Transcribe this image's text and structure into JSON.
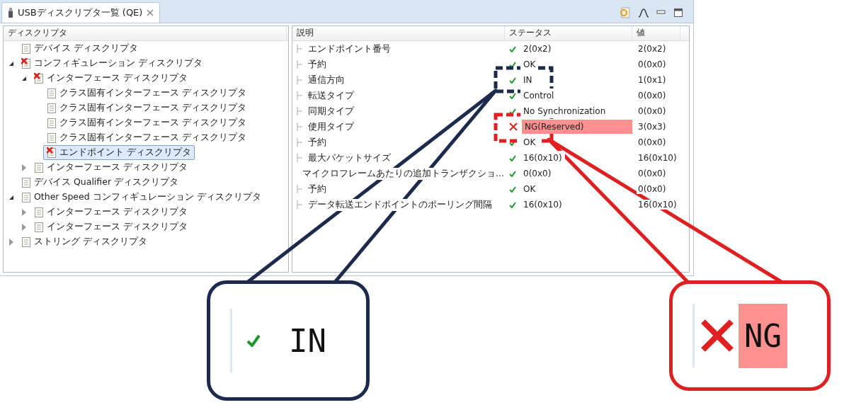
{
  "window": {
    "title": "USBディスクリプタ一覧 (QE)"
  },
  "tree": {
    "header": "ディスクリプタ",
    "items": [
      {
        "label": "デバイス ディスクリプタ",
        "error": false,
        "selected": false
      },
      {
        "label": "コンフィギュレーション ディスクリプタ",
        "error": true,
        "selected": false,
        "expanded": true,
        "children": [
          {
            "label": "インターフェース ディスクリプタ",
            "error": true,
            "selected": false,
            "expanded": true,
            "children": [
              {
                "label": "クラス固有インターフェース ディスクリプタ",
                "error": false,
                "selected": false
              },
              {
                "label": "クラス固有インターフェース ディスクリプタ",
                "error": false,
                "selected": false
              },
              {
                "label": "クラス固有インターフェース ディスクリプタ",
                "error": false,
                "selected": false
              },
              {
                "label": "クラス固有インターフェース ディスクリプタ",
                "error": false,
                "selected": false
              },
              {
                "label": "エンドポイント ディスクリプタ",
                "error": true,
                "selected": true
              }
            ]
          },
          {
            "label": "インターフェース ディスクリプタ",
            "error": false,
            "selected": false,
            "expanded": false
          }
        ]
      },
      {
        "label": "デバイス Qualifier ディスクリプタ",
        "error": false,
        "selected": false
      },
      {
        "label": "Other Speed コンフィギュレーション ディスクリプタ",
        "error": false,
        "selected": false,
        "expanded": true,
        "children": [
          {
            "label": "インターフェース ディスクリプタ",
            "error": false,
            "selected": false,
            "expanded": false
          },
          {
            "label": "インターフェース ディスクリプタ",
            "error": false,
            "selected": false,
            "expanded": false
          }
        ]
      },
      {
        "label": "ストリング ディスクリプタ",
        "error": false,
        "selected": false,
        "expanded": false
      }
    ]
  },
  "table": {
    "columns": [
      "説明",
      "ステータス",
      "値"
    ],
    "rows": [
      {
        "description": "エンドポイント番号",
        "ok": true,
        "status": "2(0x2)",
        "value": "2(0x2)"
      },
      {
        "description": "予約",
        "ok": true,
        "status": "OK",
        "value": "0(0x0)"
      },
      {
        "description": "通信方向",
        "ok": true,
        "status": "IN",
        "value": "1(0x1)"
      },
      {
        "description": "転送タイプ",
        "ok": true,
        "status": "Control",
        "value": "0(0x0)"
      },
      {
        "description": "同期タイプ",
        "ok": true,
        "status": "No Synchronization",
        "value": "0(0x0)"
      },
      {
        "description": "使用タイプ",
        "ok": false,
        "status": "NG(Reserved)",
        "value": "3(0x3)"
      },
      {
        "description": "予約",
        "ok": true,
        "status": "OK",
        "value": "0(0x0)"
      },
      {
        "description": "最大パケットサイズ",
        "ok": true,
        "status": "16(0x10)",
        "value": "16(0x10)"
      },
      {
        "description": "マイクロフレームあたりの追加トランザクショ...",
        "ok": true,
        "status": "0(0x0)",
        "value": "0(0x0)"
      },
      {
        "description": "予約",
        "ok": true,
        "status": "OK",
        "value": "0(0x0)"
      },
      {
        "description": "データ転送エンドポイントのポーリング間隔",
        "ok": true,
        "status": "16(0x10)",
        "value": "16(0x10)"
      }
    ]
  },
  "callouts": [
    {
      "kind": "ok",
      "text": "IN"
    },
    {
      "kind": "error",
      "text": "NG"
    }
  ]
}
